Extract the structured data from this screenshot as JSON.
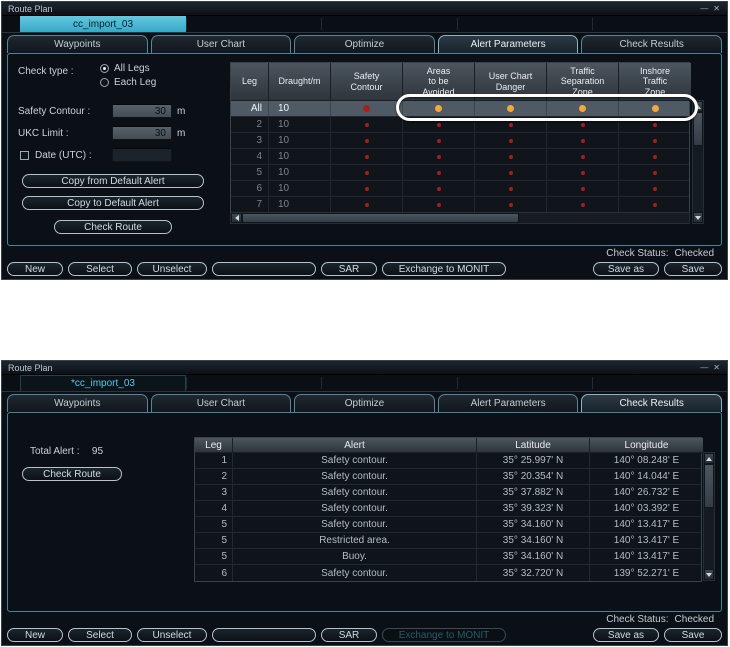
{
  "shared": {
    "window_title": "Route Plan",
    "titlebar_icons": {
      "minimize": "—",
      "close": "✕"
    },
    "tabs": [
      "Waypoints",
      "User Chart",
      "Optimize",
      "Alert Parameters",
      "Check Results"
    ],
    "status": {
      "label": "Check Status:",
      "value": "Checked"
    },
    "footer": {
      "new": "New",
      "select": "Select",
      "unselect": "Unselect",
      "blank": "",
      "sar": "SAR",
      "exchange": "Exchange to MONIT",
      "save_as": "Save as",
      "save": "Save"
    },
    "colors": {
      "red_dot": "#a32020",
      "orange_dot": "#f2a83c",
      "accent_cyan": "#52c0da"
    }
  },
  "win1": {
    "route_tab": "cc_import_03",
    "active_tab": "Alert Parameters",
    "form": {
      "check_type_label": "Check type :",
      "all_legs": "All Legs",
      "each_leg": "Each Leg",
      "safety_contour_label": "Safety Contour :",
      "safety_contour_value": "30",
      "safety_contour_unit": "m",
      "ukc_label": "UKC Limit :",
      "ukc_value": "30",
      "ukc_unit": "m",
      "date_label": "Date (UTC) :",
      "date_value": "",
      "copy_from": "Copy from Default Alert",
      "copy_to": "Copy to Default Alert",
      "check_route": "Check Route"
    },
    "table": {
      "headers": [
        "Leg",
        "Draught/m",
        "Safety\nContour",
        "Areas\nto be\nAvoided",
        "User Chart\nDanger",
        "Traffic\nSeparation\nZone",
        "Inshore\nTraffic\nZone"
      ],
      "rows": [
        {
          "leg": "All",
          "draught": "10",
          "dots": [
            "red",
            "orange",
            "orange",
            "orange",
            "orange"
          ],
          "selected": true
        },
        {
          "leg": "2",
          "draught": "10",
          "dots": [
            "red",
            "red",
            "red",
            "red",
            "red"
          ],
          "selected": false
        },
        {
          "leg": "3",
          "draught": "10",
          "dots": [
            "red",
            "red",
            "red",
            "red",
            "red"
          ],
          "selected": false
        },
        {
          "leg": "4",
          "draught": "10",
          "dots": [
            "red",
            "red",
            "red",
            "red",
            "red"
          ],
          "selected": false
        },
        {
          "leg": "5",
          "draught": "10",
          "dots": [
            "red",
            "red",
            "red",
            "red",
            "red"
          ],
          "selected": false
        },
        {
          "leg": "6",
          "draught": "10",
          "dots": [
            "red",
            "red",
            "red",
            "red",
            "red"
          ],
          "selected": false
        },
        {
          "leg": "7",
          "draught": "10",
          "dots": [
            "red",
            "red",
            "red",
            "red",
            "red"
          ],
          "selected": false
        }
      ]
    }
  },
  "win2": {
    "route_tab": "*cc_import_03",
    "active_tab": "Check Results",
    "total_alert_label": "Total Alert :",
    "total_alert_value": "95",
    "check_route": "Check Route",
    "exchange_disabled": true,
    "table": {
      "headers": [
        "Leg",
        "Alert",
        "Latitude",
        "Longitude"
      ],
      "rows": [
        {
          "leg": "1",
          "alert": "Safety contour.",
          "lat": "35° 25.997' N",
          "lon": "140° 08.248' E"
        },
        {
          "leg": "2",
          "alert": "Safety contour.",
          "lat": "35° 20.354' N",
          "lon": "140° 14.044' E"
        },
        {
          "leg": "3",
          "alert": "Safety contour.",
          "lat": "35° 37.882' N",
          "lon": "140° 26.732' E"
        },
        {
          "leg": "4",
          "alert": "Safety contour.",
          "lat": "35° 39.323' N",
          "lon": "140° 03.392' E"
        },
        {
          "leg": "5",
          "alert": "Safety contour.",
          "lat": "35° 34.160' N",
          "lon": "140° 13.417' E"
        },
        {
          "leg": "5",
          "alert": "Restricted area.",
          "lat": "35° 34.160' N",
          "lon": "140° 13.417' E"
        },
        {
          "leg": "5",
          "alert": "Buoy.",
          "lat": "35° 34.160' N",
          "lon": "140° 13.417' E"
        },
        {
          "leg": "6",
          "alert": "Safety contour.",
          "lat": "35° 32.720' N",
          "lon": "139° 52.271' E"
        }
      ]
    }
  }
}
